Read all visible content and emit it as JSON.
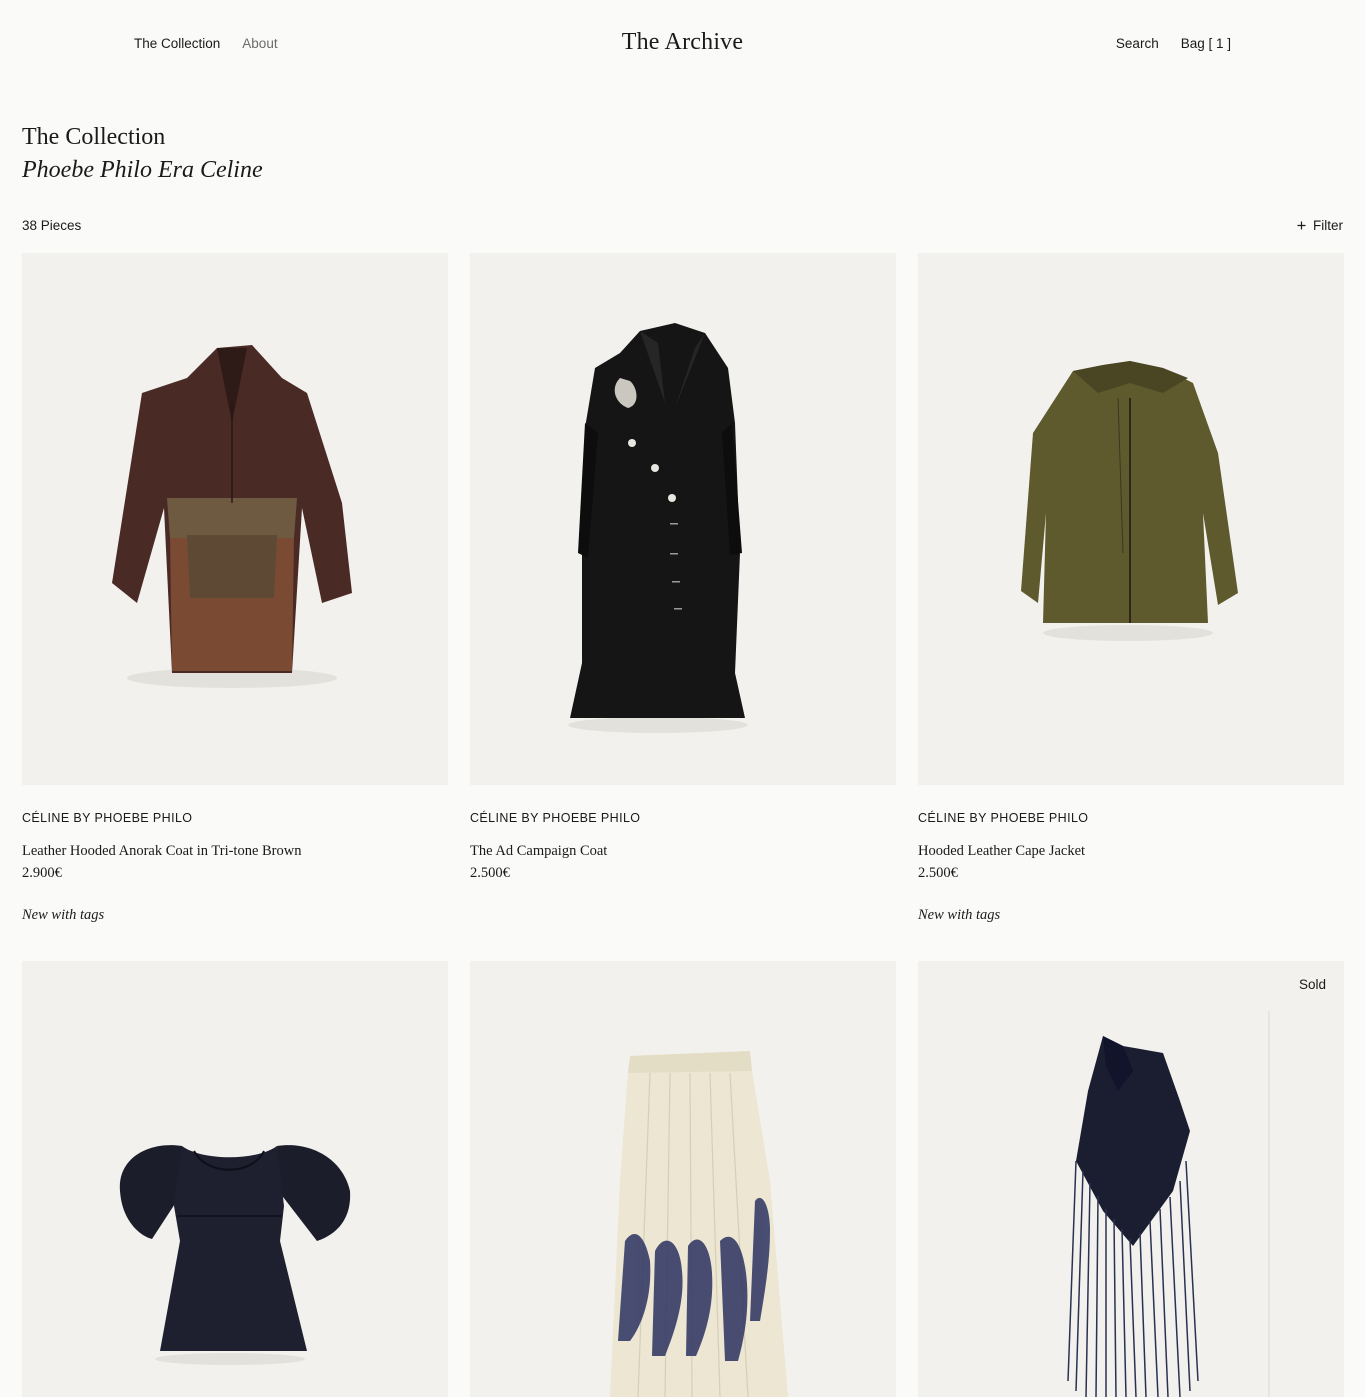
{
  "header": {
    "nav_left": [
      "The Collection",
      "About"
    ],
    "logo": "The Archive",
    "search_label": "Search",
    "bag_label": "Bag [ 1 ]"
  },
  "collection": {
    "title": "The Collection",
    "subtitle": "Phoebe Philo Era Celine",
    "count": "38 Pieces",
    "filter_label": "Filter",
    "filter_icon": "plus-icon"
  },
  "products": [
    {
      "brand": "CÉLINE BY PHOEBE PHILO",
      "name": "Leather Hooded Anorak Coat in Tri-tone Brown",
      "price": "2.900€",
      "condition": "New with tags",
      "sold": ""
    },
    {
      "brand": "CÉLINE BY PHOEBE PHILO",
      "name": "The Ad Campaign Coat",
      "price": "2.500€",
      "condition": "",
      "sold": ""
    },
    {
      "brand": "CÉLINE BY PHOEBE PHILO",
      "name": "Hooded Leather Cape Jacket",
      "price": "2.500€",
      "condition": "New with tags",
      "sold": ""
    },
    {
      "brand": "",
      "name": "",
      "price": "",
      "condition": "",
      "sold": ""
    },
    {
      "brand": "",
      "name": "",
      "price": "",
      "condition": "",
      "sold": ""
    },
    {
      "brand": "",
      "name": "",
      "price": "",
      "condition": "",
      "sold": "Sold"
    }
  ],
  "colors": {
    "background": "#fafaf9",
    "card_background": "#f2f1ee",
    "text": "#1a1a1a",
    "muted_text": "#6b6b6b"
  }
}
